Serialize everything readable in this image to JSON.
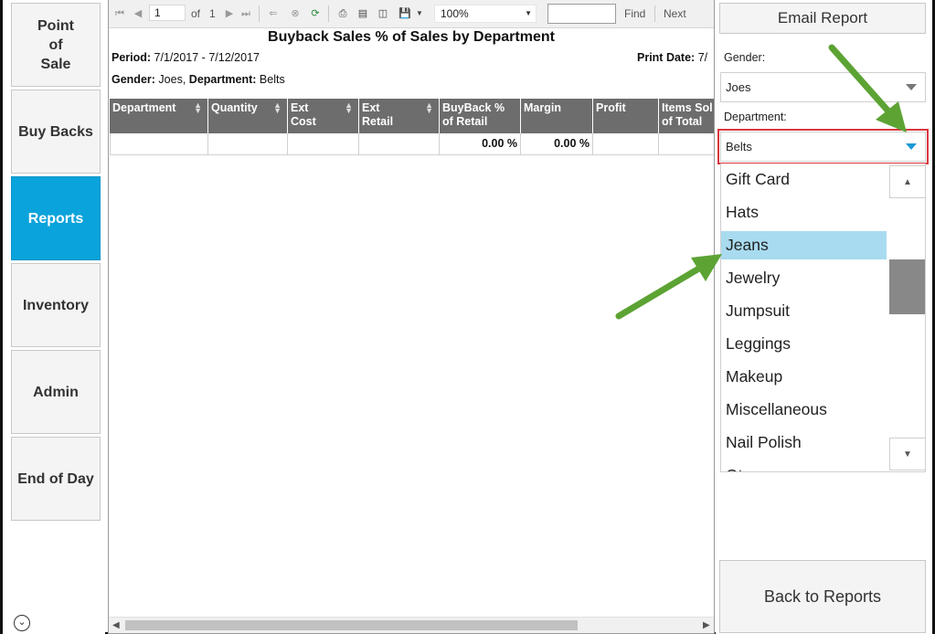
{
  "nav": {
    "items": [
      {
        "label": "Point\nof\nSale",
        "active": false
      },
      {
        "label": "Buy Backs",
        "active": false
      },
      {
        "label": "Reports",
        "active": true
      },
      {
        "label": "Inventory",
        "active": false
      },
      {
        "label": "Admin",
        "active": false
      },
      {
        "label": "End of Day",
        "active": false
      }
    ],
    "bottom_icon": "chevron-down-circle-icon"
  },
  "toolbar": {
    "page_value": "1",
    "of_label": "of",
    "total_pages": "1",
    "zoom_value": "100%",
    "find_label": "Find",
    "next_label": "Next",
    "find_value": ""
  },
  "report": {
    "title": "Buyback Sales % of Sales by Department",
    "period_label": "Period:",
    "period_value": "7/1/2017 - 7/12/2017",
    "print_date_label": "Print Date:",
    "print_date_value": "7/",
    "gender_label": "Gender:",
    "gender_value": "Joes,",
    "department_label": "Department:",
    "department_value": "Belts",
    "columns": [
      "Department",
      "Quantity",
      "Ext\nCost",
      "Ext\nRetail",
      "BuyBack %\nof Retail",
      "Margin",
      "Profit",
      "Items Sol\nof Total"
    ],
    "row": [
      "",
      "",
      "",
      "",
      "0.00 %",
      "0.00 %",
      "",
      ""
    ]
  },
  "panel": {
    "email_button": "Email Report",
    "gender_label": "Gender:",
    "gender_value": "Joes",
    "department_label": "Department:",
    "department_value": "Belts",
    "options": [
      "Gift Card",
      "Hats",
      "Jeans",
      "Jewelry",
      "Jumpsuit",
      "Leggings",
      "Makeup",
      "Miscellaneous",
      "Nail Polish",
      "Ot"
    ],
    "selected_option": "Jeans",
    "back_button": "Back to Reports"
  },
  "colors": {
    "active_nav": "#0aa3db",
    "selection": "#a8dbef",
    "highlight_border": "#d9363e",
    "annotation_arrow": "#5ca334",
    "table_header": "#6d6d6d"
  }
}
